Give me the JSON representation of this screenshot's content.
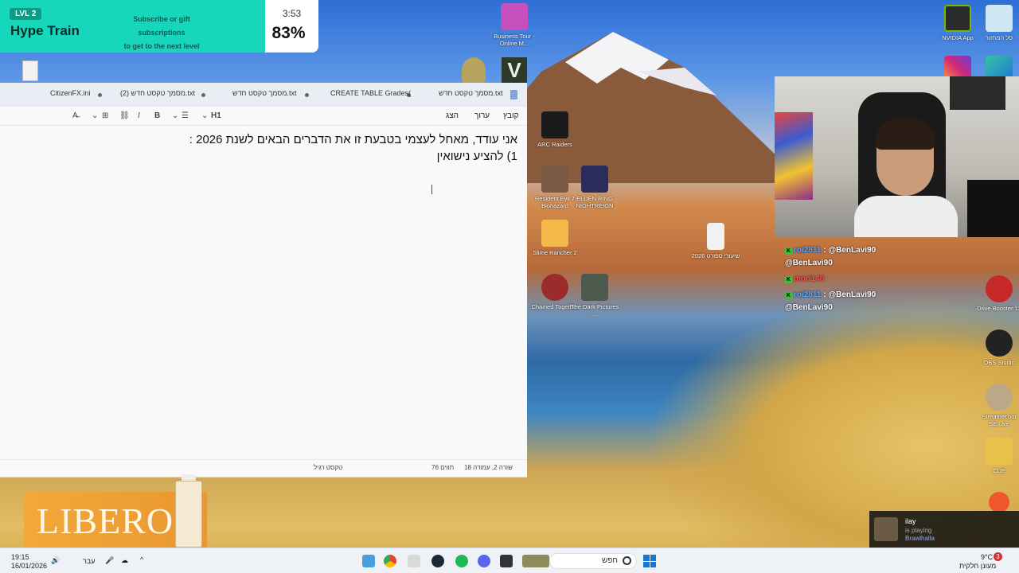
{
  "hype_train": {
    "level": "LVL 2",
    "title": "Hype Train",
    "message_line1": "Subscribe or gift subscriptions",
    "message_line2": "to get to the next level",
    "timer": "3:53",
    "progress": "83%"
  },
  "notepad": {
    "tabs": [
      {
        "label": "מסמך טקסט חדש.txt"
      },
      {
        "label": "CREATE TABLE Grades("
      },
      {
        "label": "מסמך טקסט חדש.txt"
      },
      {
        "label": "מסמך טקסט חדש (2).txt"
      },
      {
        "label": "CitizenFX.ini"
      }
    ],
    "menu": {
      "file": "קובץ",
      "edit": "ערוך",
      "view": "הצג"
    },
    "toolbar": {
      "heading": "H1"
    },
    "lines": [
      "אני עודד, מאחל לעצמי בטבעת זו את הדברים הבאים לשנת 2026 :",
      "1) להציע נישואין"
    ],
    "status": {
      "position": "שורה 2, עמודה 18",
      "chars": "76 תווים",
      "format": "טקסט רגיל"
    }
  },
  "desktop_icons": [
    {
      "label": "Business Tour - Online M..."
    },
    {
      "label": "NVIDIA App"
    },
    {
      "label": "סל המחזור"
    },
    {
      "label": "ARC Raiders"
    },
    {
      "label": "Resident Evil 7 Biohazard"
    },
    {
      "label": "ELDEN RING NIGHTREIGN"
    },
    {
      "label": "Slime Rancher 2"
    },
    {
      "label": "Chained Together"
    },
    {
      "label": "The Dark Pictures ..."
    },
    {
      "label": "שיעורי ספורט 2026"
    },
    {
      "label": "Drive Booster 13"
    },
    {
      "label": "OBS Studio"
    },
    {
      "label": "Streamer.bot SE.Live"
    },
    {
      "label": "CUE"
    }
  ],
  "chat": {
    "lines": [
      {
        "user": "roi2811",
        "text": "@BenLavi90"
      },
      {
        "user": "",
        "text": "@BenLavi90"
      },
      {
        "user": "mori146",
        "text": ""
      },
      {
        "user": "roi2811",
        "text": "@BenLavi90"
      },
      {
        "user": "",
        "text": "@BenLavi90"
      }
    ]
  },
  "notification": {
    "name": "ilay",
    "status": "is playing",
    "game": "Brawlhalla"
  },
  "ad": {
    "brand": "LIBERO"
  },
  "taskbar": {
    "search": "חפש",
    "time": "19:15",
    "date": "16/01/2026",
    "language": "עבר",
    "weather_temp": "9°C",
    "weather_desc": "מעונן חלקית",
    "notif_count": "3"
  }
}
